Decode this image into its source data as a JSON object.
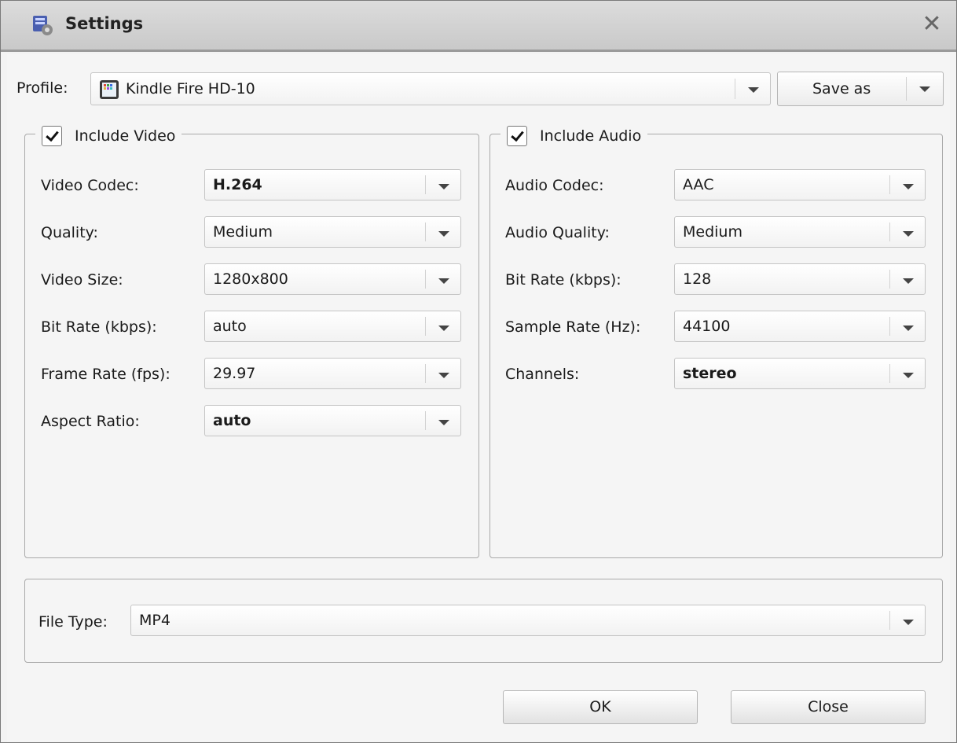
{
  "window": {
    "title": "Settings",
    "close_glyph": "✕"
  },
  "profile": {
    "label": "Profile:",
    "value": "Kindle Fire HD-10",
    "icon": "tablet-icon",
    "save_as_label": "Save as"
  },
  "video": {
    "include_label": "Include Video",
    "include_checked": true,
    "fields": [
      {
        "label": "Video Codec:",
        "value": "H.264"
      },
      {
        "label": "Quality:",
        "value": "Medium"
      },
      {
        "label": "Video Size:",
        "value": "1280x800"
      },
      {
        "label": "Bit Rate (kbps):",
        "value": "auto"
      },
      {
        "label": "Frame Rate (fps):",
        "value": "29.97"
      },
      {
        "label": "Aspect Ratio:",
        "value": "auto"
      }
    ]
  },
  "audio": {
    "include_label": "Include Audio",
    "include_checked": true,
    "fields": [
      {
        "label": "Audio Codec:",
        "value": "AAC"
      },
      {
        "label": "Audio Quality:",
        "value": "Medium"
      },
      {
        "label": "Bit Rate (kbps):",
        "value": "128"
      },
      {
        "label": "Sample Rate (Hz):",
        "value": "44100"
      },
      {
        "label": "Channels:",
        "value": "stereo"
      }
    ]
  },
  "file_type": {
    "label": "File Type:",
    "value": "MP4"
  },
  "buttons": {
    "ok": "OK",
    "close": "Close"
  }
}
